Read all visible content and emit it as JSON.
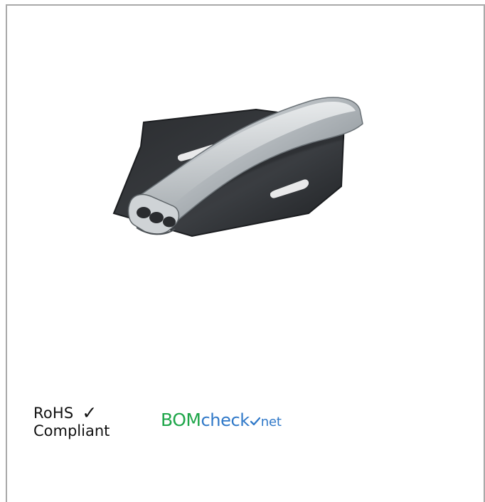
{
  "badges": {
    "rohs": {
      "line1": "RoHS",
      "line2": "Compliant",
      "icon": "check-icon"
    },
    "bomcheck": {
      "part1": "BOM",
      "part2": "check",
      "part3": "net",
      "colors": {
        "green": "#1fa64a",
        "blue": "#2f78c8"
      }
    }
  },
  "colors": {
    "frame": "#a9a9a9",
    "background": "#ffffff",
    "product_dark": "#2e3134",
    "product_light": "#b8bdc1"
  }
}
